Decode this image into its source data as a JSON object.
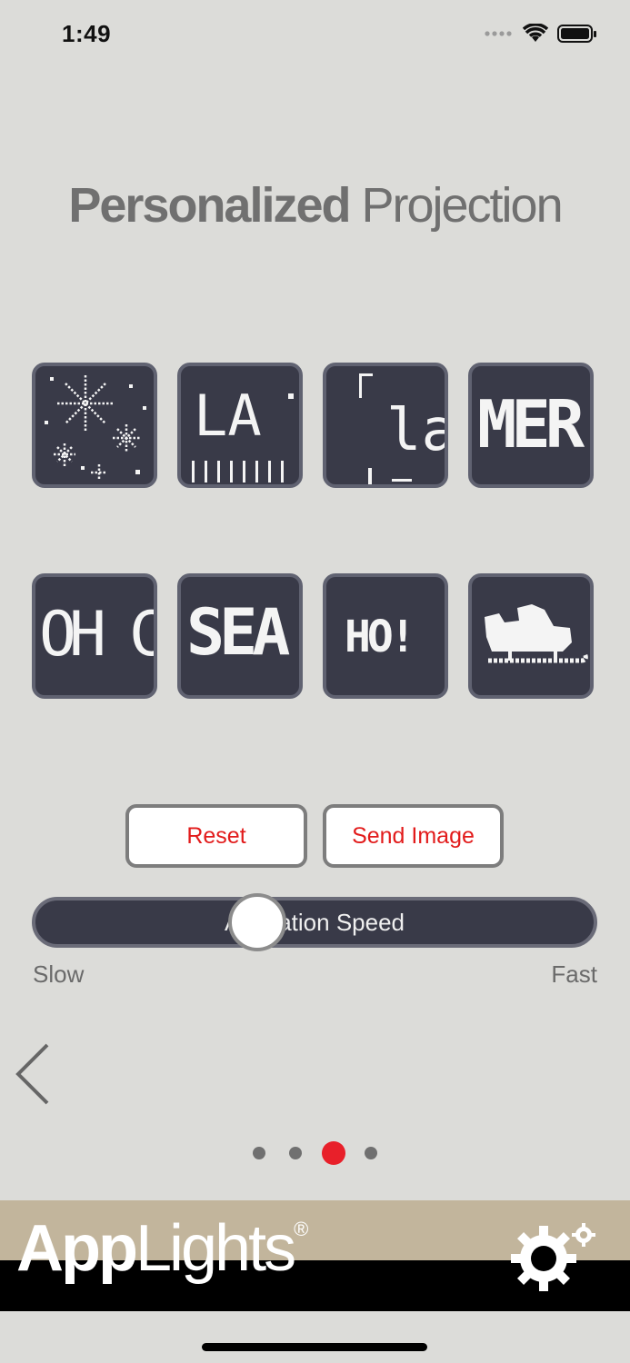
{
  "status_bar": {
    "time": "1:49"
  },
  "title": {
    "bold": "Personalized",
    "regular": " Projection"
  },
  "tiles": [
    {
      "text": ""
    },
    {
      "text": "LA"
    },
    {
      "text": "la"
    },
    {
      "text": "MER"
    },
    {
      "text": "OH C"
    },
    {
      "text": "SEA"
    },
    {
      "text": "HO!"
    },
    {
      "text": ""
    }
  ],
  "buttons": {
    "reset": "Reset",
    "send_image": "Send Image"
  },
  "slider": {
    "label": "Animation Speed",
    "min_label": "Slow",
    "max_label": "Fast",
    "value": 0.4
  },
  "pager": {
    "count": 4,
    "active_index": 2
  },
  "footer": {
    "logo_bold": "App",
    "logo_regular": "Lights",
    "registered": "®"
  },
  "colors": {
    "accent": "#e8202a",
    "tile_bg": "#393a48",
    "footer_beige": "#c2b59c"
  }
}
